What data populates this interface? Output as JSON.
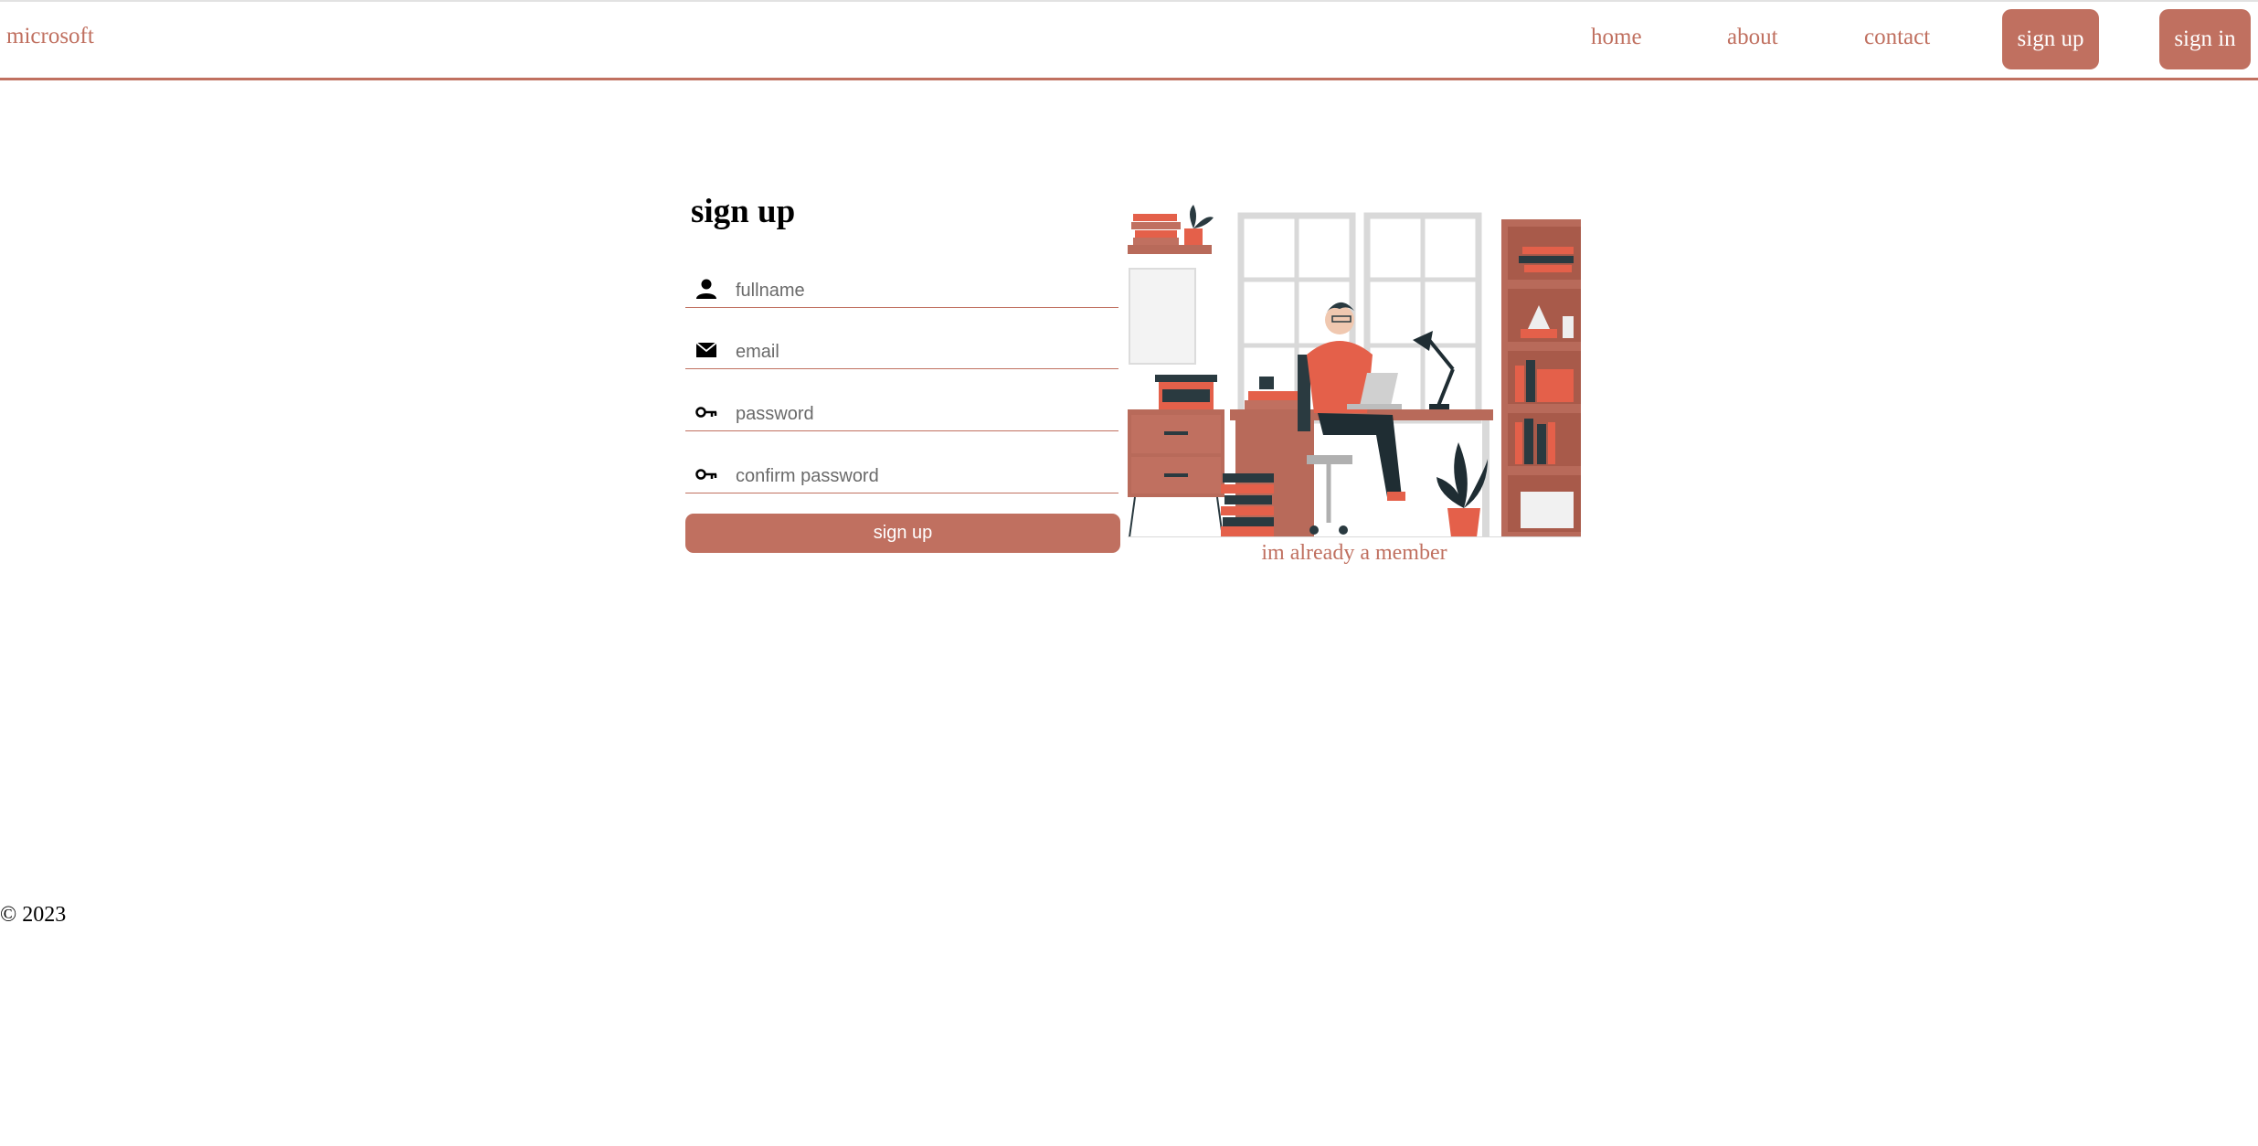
{
  "navbar": {
    "brand": "microsoft",
    "links": [
      "home",
      "about",
      "contact"
    ],
    "signup_label": "sign up",
    "signin_label": "sign in"
  },
  "form": {
    "title": "sign up",
    "fields": [
      {
        "icon": "user-icon",
        "placeholder": "fullname"
      },
      {
        "icon": "envelope-icon",
        "placeholder": "email"
      },
      {
        "icon": "key-icon",
        "placeholder": "password"
      },
      {
        "icon": "key-icon",
        "placeholder": "confirm password"
      }
    ],
    "submit_label": "sign up"
  },
  "illustration": {
    "member_link": "im already a member"
  },
  "footer": {
    "copyright": "© 2023"
  },
  "colors": {
    "accent": "#c07060",
    "text": "#000000",
    "background": "#ffffff"
  }
}
